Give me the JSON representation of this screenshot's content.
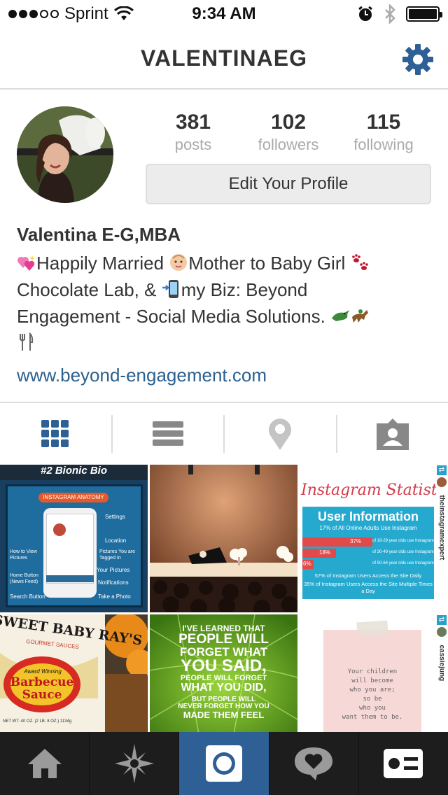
{
  "status_bar": {
    "carrier": "Sprint",
    "time": "9:34 AM"
  },
  "header": {
    "title": "VALENTINAEG"
  },
  "stats": [
    {
      "value": "381",
      "label": "posts"
    },
    {
      "value": "102",
      "label": "followers"
    },
    {
      "value": "115",
      "label": "following"
    }
  ],
  "edit_profile_label": "Edit Your Profile",
  "bio": {
    "name": "Valentina E-G,MBA",
    "line1_a": "Happily Married ",
    "line1_b": "Mother to Baby Girl ",
    "line2_a": "Chocolate Lab, & ",
    "line2_b": "my Biz: Beyond",
    "line3": "Engagement - Social Media Solutions. ",
    "link": "www.beyond-engagement.com"
  },
  "grid": {
    "post1": {
      "title": "#2 Bionic Bio",
      "banner": "INSTAGRAM ANATOMY",
      "labels": [
        "Settings",
        "How to View Pictures",
        "Location",
        "Pictures You are Tagged In",
        "Home Button (News Feed)",
        "Your Pictures",
        "Notifications",
        "Search Button",
        "Take a Photo"
      ]
    },
    "post3": {
      "title": "Instagram Statistic",
      "subtitle": "User Information",
      "line": "17% of All Online Adults Use Instagram",
      "pct1": "37%",
      "pct2": "18%",
      "pct3": "6%",
      "age1": "of 18-29 year olds use Instagram",
      "age2": "of 30-49 year olds use Instagram",
      "age3": "of 50-64 year olds use Instagram",
      "foot1": "57% of Instagram Users Access the Site Daily",
      "foot2": "35% of Instagram Users Access the Site Multiple Times a Day",
      "repost_user": "theinstagramexpert"
    },
    "post4": {
      "brand": "SWEET BABY RAY'S",
      "sub": "GOURMET SAUCES",
      "award": "Award Winning",
      "product": "Barbecue Sauce",
      "net": "NET WT. 40 OZ. (2 LB. 8 OZ.) 1134g"
    },
    "post5": {
      "lines": [
        "I'VE LEARNED THAT",
        "PEOPLE WILL",
        "FORGET WHAT",
        "YOU SAID,",
        "PEOPLE WILL FORGET",
        "WHAT YOU DID,",
        "BUT PEOPLE WILL",
        "NEVER FORGET HOW YOU",
        "MADE THEM FEEL"
      ]
    },
    "post6": {
      "quote": [
        "Your children",
        "will become",
        "who you are;",
        "so be",
        "who you",
        "want them to be."
      ],
      "repost_user": "cassiejung"
    }
  },
  "colors": {
    "link": "#2b5f8e",
    "accent": "#2e6095",
    "nav_bg": "#1d1d1d"
  }
}
